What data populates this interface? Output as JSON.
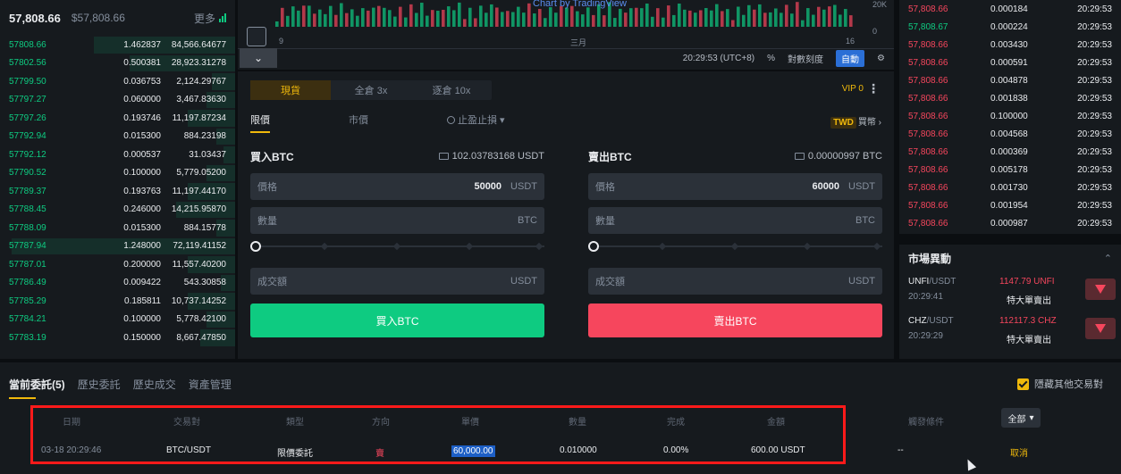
{
  "orderbook": {
    "price": "57,808.66",
    "sub_price": "$57,808.66",
    "more": "更多",
    "rows": [
      {
        "price": "57808.66",
        "amount": "1.462837",
        "total": "84,566.64677",
        "depth": 0.6
      },
      {
        "price": "57802.56",
        "amount": "0.500381",
        "total": "28,923.31278",
        "depth": 0.45
      },
      {
        "price": "57799.50",
        "amount": "0.036753",
        "total": "2,124.29767",
        "depth": 0.1
      },
      {
        "price": "57797.27",
        "amount": "0.060000",
        "total": "3,467.83630",
        "depth": 0.12
      },
      {
        "price": "57797.26",
        "amount": "0.193746",
        "total": "11,197.87234",
        "depth": 0.2
      },
      {
        "price": "57792.94",
        "amount": "0.015300",
        "total": "884.23198",
        "depth": 0.08
      },
      {
        "price": "57792.12",
        "amount": "0.000537",
        "total": "31.03437",
        "depth": 0.05
      },
      {
        "price": "57790.52",
        "amount": "0.100000",
        "total": "5,779.05200",
        "depth": 0.12
      },
      {
        "price": "57789.37",
        "amount": "0.193763",
        "total": "11,197.44170",
        "depth": 0.2
      },
      {
        "price": "57788.45",
        "amount": "0.246000",
        "total": "14,215.95870",
        "depth": 0.25
      },
      {
        "price": "57788.09",
        "amount": "0.015300",
        "total": "884.15778",
        "depth": 0.08
      },
      {
        "price": "57787.94",
        "amount": "1.248000",
        "total": "72,119.41152",
        "depth": 0.95
      },
      {
        "price": "57787.01",
        "amount": "0.200000",
        "total": "11,557.40200",
        "depth": 0.2
      },
      {
        "price": "57786.49",
        "amount": "0.009422",
        "total": "543.30858",
        "depth": 0.06
      },
      {
        "price": "57785.29",
        "amount": "0.185811",
        "total": "10,737.14252",
        "depth": 0.2
      },
      {
        "price": "57784.21",
        "amount": "0.100000",
        "total": "5,778.42100",
        "depth": 0.12
      },
      {
        "price": "57783.19",
        "amount": "0.150000",
        "total": "8,667.47850",
        "depth": 0.15
      }
    ]
  },
  "chart": {
    "watermark": "Chart by TradingView",
    "scale": [
      "20K",
      "0"
    ],
    "x_labels": [
      {
        "label": "9"
      },
      {
        "label": "三月"
      },
      {
        "label": "16"
      }
    ],
    "toolbar": {
      "time": "20:29:53 (UTC+8)",
      "percent": "%",
      "log": "對數刻度",
      "auto": "自動",
      "settings": "⚙"
    },
    "collapse": "⌄"
  },
  "trade": {
    "mode_tabs": [
      "現貨",
      "全倉 3x",
      "逐倉 10x"
    ],
    "vip": "VIP 0",
    "order_tabs": {
      "limit": "限價",
      "market": "市價",
      "stop": "止盈止損"
    },
    "two_badge": {
      "tag": "TWD",
      "text": "買幣"
    },
    "buy": {
      "title": "買入BTC",
      "balance": "102.03783168 USDT",
      "price_label": "價格",
      "price": "50000",
      "price_unit": "USDT",
      "qty_label": "數量",
      "qty_unit": "BTC",
      "total_label": "成交額",
      "total_unit": "USDT",
      "button": "買入BTC"
    },
    "sell": {
      "title": "賣出BTC",
      "balance": "0.00000997 BTC",
      "price_label": "價格",
      "price": "60000",
      "price_unit": "USDT",
      "qty_label": "數量",
      "qty_unit": "BTC",
      "total_label": "成交額",
      "total_unit": "USDT",
      "button": "賣出BTC"
    }
  },
  "trades": [
    {
      "price": "57,808.66",
      "amount": "0.000184",
      "time": "20:29:53",
      "side": "red"
    },
    {
      "price": "57,808.67",
      "amount": "0.000224",
      "time": "20:29:53",
      "side": "green"
    },
    {
      "price": "57,808.66",
      "amount": "0.003430",
      "time": "20:29:53",
      "side": "red"
    },
    {
      "price": "57,808.66",
      "amount": "0.000591",
      "time": "20:29:53",
      "side": "red"
    },
    {
      "price": "57,808.66",
      "amount": "0.004878",
      "time": "20:29:53",
      "side": "red"
    },
    {
      "price": "57,808.66",
      "amount": "0.001838",
      "time": "20:29:53",
      "side": "red"
    },
    {
      "price": "57,808.66",
      "amount": "0.100000",
      "time": "20:29:53",
      "side": "red"
    },
    {
      "price": "57,808.66",
      "amount": "0.004568",
      "time": "20:29:53",
      "side": "red"
    },
    {
      "price": "57,808.66",
      "amount": "0.000369",
      "time": "20:29:53",
      "side": "red"
    },
    {
      "price": "57,808.66",
      "amount": "0.005178",
      "time": "20:29:53",
      "side": "red"
    },
    {
      "price": "57,808.66",
      "amount": "0.001730",
      "time": "20:29:53",
      "side": "red"
    },
    {
      "price": "57,808.66",
      "amount": "0.001954",
      "time": "20:29:53",
      "side": "red"
    },
    {
      "price": "57,808.66",
      "amount": "0.000987",
      "time": "20:29:53",
      "side": "red"
    }
  ],
  "market": {
    "title": "市場異動",
    "items": [
      {
        "base": "UNFI",
        "quote": "/USDT",
        "time": "20:29:41",
        "value": "1147.79 UNFI",
        "desc": "特大單賣出"
      },
      {
        "base": "CHZ",
        "quote": "/USDT",
        "time": "20:29:29",
        "value": "112117.3 CHZ",
        "desc": "特大單賣出"
      }
    ]
  },
  "orders": {
    "tabs": [
      "當前委託(5)",
      "歷史委託",
      "歷史成交",
      "資產管理"
    ],
    "hide_other": "隱藏其他交易對",
    "headers": {
      "date": "日期",
      "pair": "交易對",
      "type": "類型",
      "side": "方向",
      "price": "單價",
      "qty": "數量",
      "filled": "完成",
      "total": "金額",
      "trigger": "觸發條件"
    },
    "filter": "全部",
    "row": {
      "date": "03-18 20:29:46",
      "pair": "BTC/USDT",
      "type": "限價委託",
      "side": "賣",
      "price": "60,000.00",
      "qty": "0.010000",
      "filled": "0.00%",
      "total": "600.00 USDT",
      "trigger": "--",
      "action": "取消"
    }
  }
}
